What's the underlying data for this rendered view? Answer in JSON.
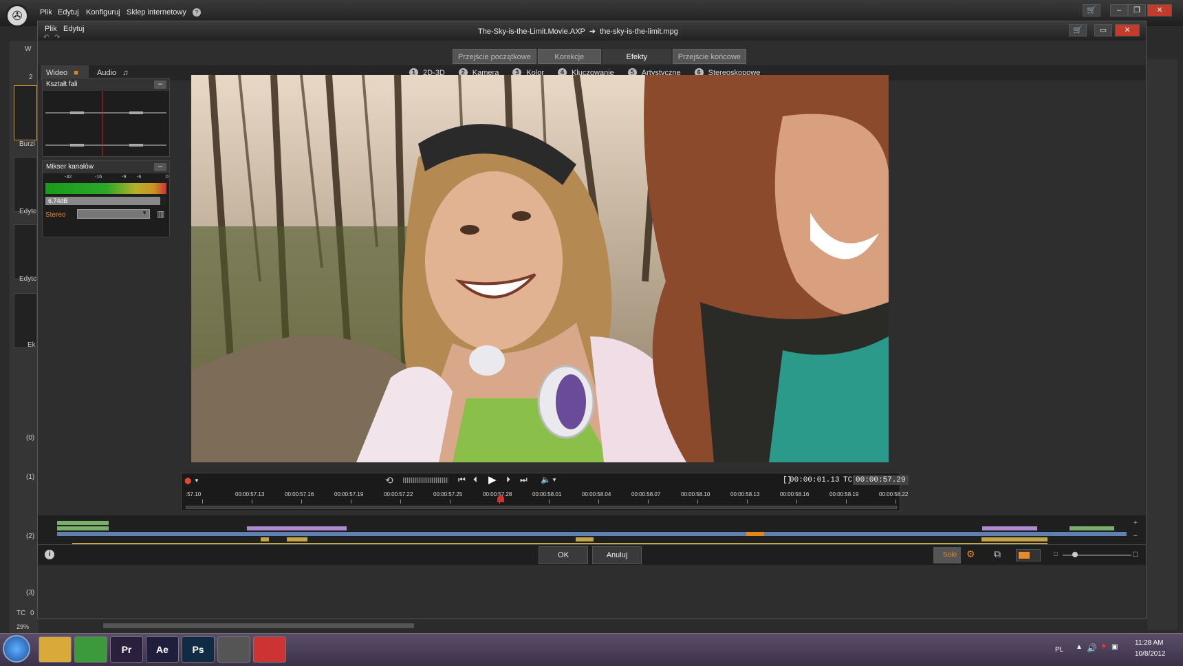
{
  "outer": {
    "menu": [
      "Plik",
      "Edytuj",
      "Konfiguruj",
      "Sklep internetowy"
    ],
    "help": "?",
    "left_strip": {
      "labels": [
        "W",
        "2",
        "Burzl",
        "Edytc",
        "Edytc",
        "Ek",
        "TC",
        "29%"
      ],
      "track_labels": [
        "(0)",
        "(1)",
        "(2)",
        "(3)"
      ],
      "tc_value": "0"
    }
  },
  "dialog": {
    "menu": [
      "Plik",
      "Edytuj"
    ],
    "title_project": "The-Sky-is-the-Limit.Movie.AXP",
    "title_arrow": "➔",
    "title_file": "the-sky-is-the-limit.mpg",
    "category_tabs": [
      "Przejście początkowe",
      "Korekcje",
      "Efekty",
      "Przejście końcowe"
    ],
    "active_tab": "Efekty",
    "media_tabs": {
      "video": "Wideo",
      "audio": "Audio"
    },
    "subcategories": [
      {
        "num": "1",
        "label": "2D-3D"
      },
      {
        "num": "2",
        "label": "Kamera"
      },
      {
        "num": "3",
        "label": "Kolor"
      },
      {
        "num": "4",
        "label": "Kluczowanie"
      },
      {
        "num": "5",
        "label": "Artystyczne"
      },
      {
        "num": "6",
        "label": "Stereoskopowe"
      }
    ]
  },
  "waveform_panel": {
    "title": "Kształt fali",
    "min": "–"
  },
  "mixer_panel": {
    "title": "Mikser kanałów",
    "min": "–",
    "scale": [
      "-32",
      "-16",
      "-9",
      "-6",
      "0"
    ],
    "level": "6.74dB",
    "level_fraction": 0.95,
    "mode": "Stereo",
    "dropdown_value": ""
  },
  "transport": {
    "in_marker": "[]",
    "duration": "00:00:01.13",
    "tc_label": "TC",
    "timecode": "00:00:57.29",
    "ruler": [
      ":57.10",
      "00:00:57.13",
      "00:00:57.16",
      "00:00:57.19",
      "00:00:57.22",
      "00:00:57.25",
      "00:00:57.28",
      "00:00:58.01",
      "00:00:58.04",
      "00:00:58.07",
      "00:00:58.10",
      "00:00:58.13",
      "00:00:58.16",
      "00:00:58.19",
      "00:00:58.22"
    ]
  },
  "bottom": {
    "ok": "OK",
    "cancel": "Anuluj",
    "solo": "Solo"
  },
  "taskbar": {
    "apps": [
      {
        "name": "explorer",
        "label": "",
        "color": "#d9a93a"
      },
      {
        "name": "chrome",
        "label": "",
        "color": "#3c9a3c"
      },
      {
        "name": "premiere",
        "label": "Pr",
        "color": "#2a1f3d"
      },
      {
        "name": "aftereffects",
        "label": "Ae",
        "color": "#1f1f3d"
      },
      {
        "name": "photoshop",
        "label": "Ps",
        "color": "#0f2c44"
      },
      {
        "name": "studio",
        "label": "",
        "color": "#555"
      },
      {
        "name": "smiley",
        "label": "",
        "color": "#c33"
      }
    ],
    "lang": "PL",
    "time": "11:28 AM",
    "date": "10/8/2012"
  }
}
